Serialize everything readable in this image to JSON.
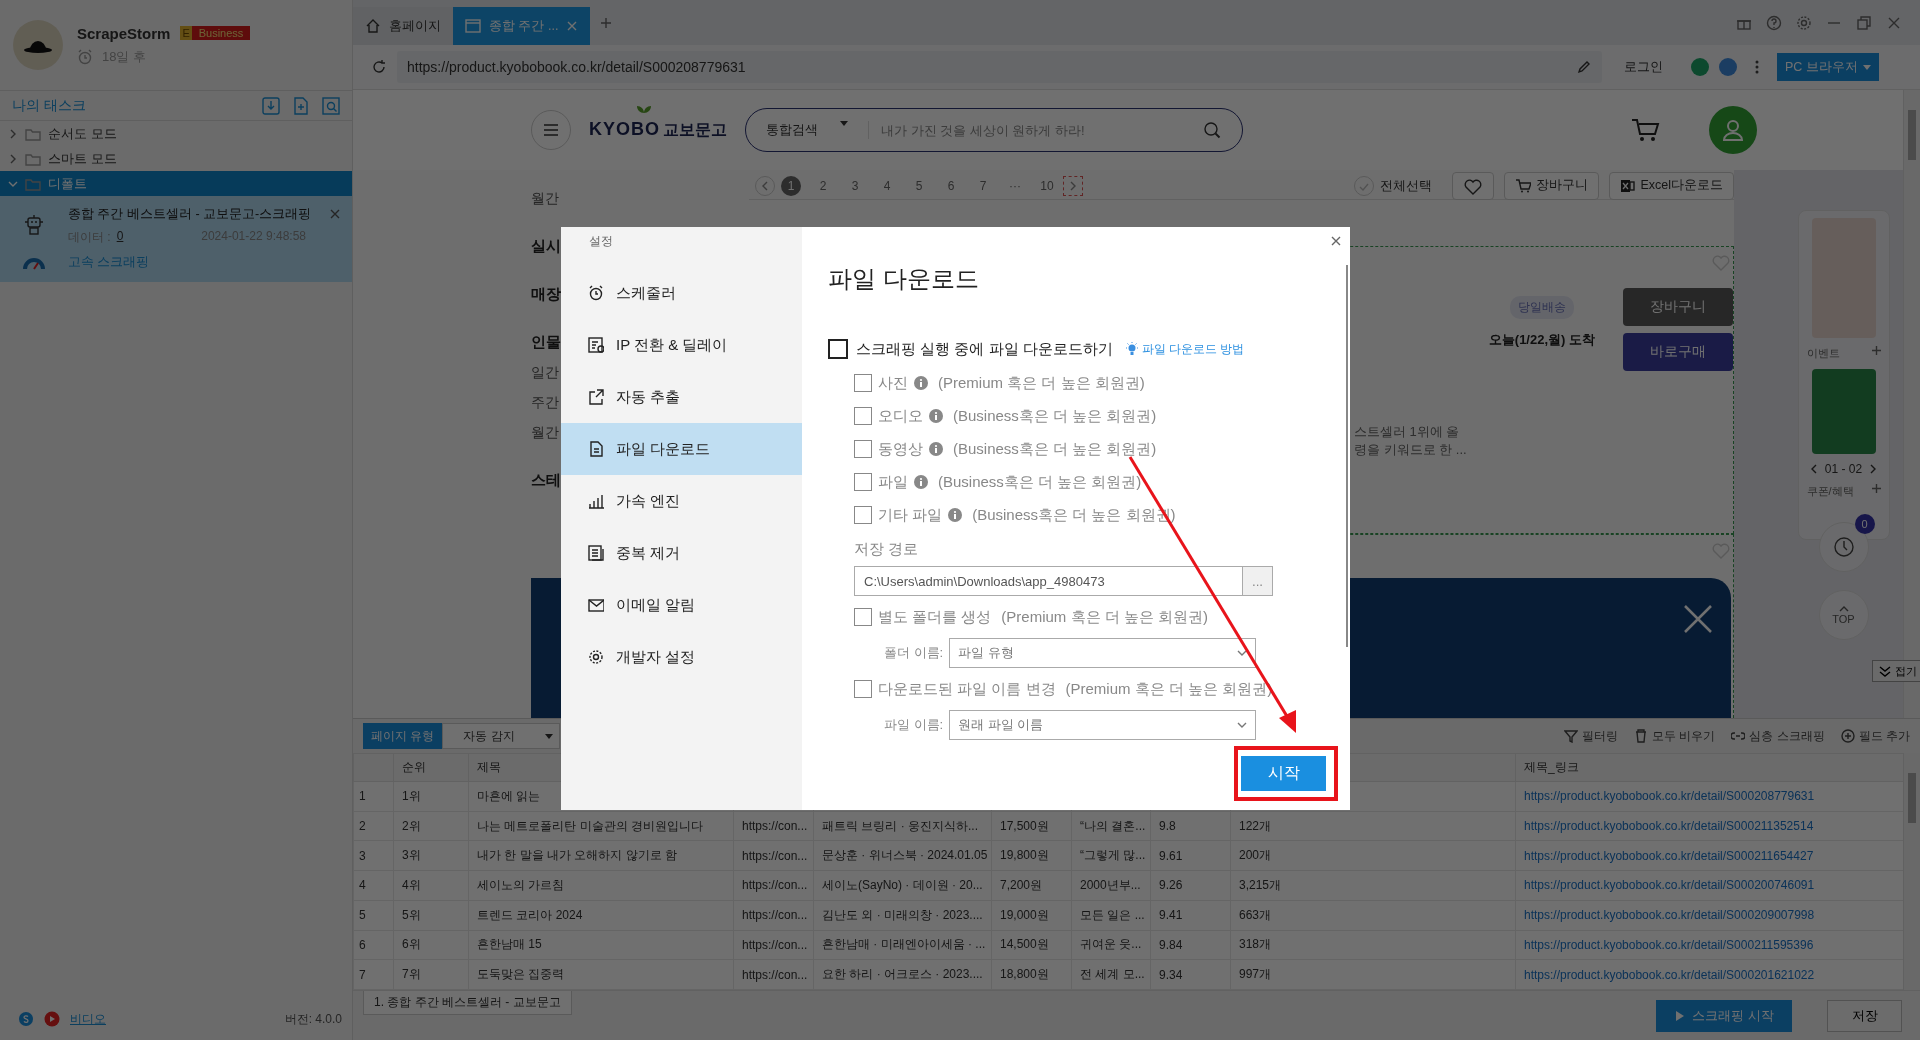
{
  "profile": {
    "app_name": "ScrapeStorm",
    "plan_letter": "E",
    "plan": "Business",
    "expiry": "18일 후"
  },
  "task_panel": {
    "title": "나의 태스크",
    "folders": [
      {
        "label": "순서도 모드",
        "expanded": false,
        "selected": false
      },
      {
        "label": "스마트 모드",
        "expanded": false,
        "selected": false
      },
      {
        "label": "디폴트",
        "expanded": true,
        "selected": true,
        "children": [
          {
            "title": "종합 주간 베스트셀러 - 교보문고-스크래핑",
            "data_label": "데이터 :",
            "data_count": "0",
            "time": "2024-01-22 9:48:58",
            "mode": "고속 스크래핑"
          }
        ]
      }
    ]
  },
  "status_left": {
    "video": "비디오",
    "version": "버전: 4.0.0"
  },
  "browser": {
    "tabs": [
      {
        "label": "홈페이지",
        "selected": false
      },
      {
        "label": "종합 주간 ...",
        "selected": true
      }
    ],
    "url": "https://product.kyobobook.co.kr/detail/S000208779631",
    "login": "로그인",
    "mode_button": "PC 브라우저"
  },
  "site": {
    "logo_latin": "KYOBO",
    "logo_korean": "교보문고",
    "search_category": "통합검색",
    "search_placeholder": "내가 가진 것을 세상이 원하게 하라!",
    "side_labels": [
      {
        "text": "월간",
        "kind": "link"
      },
      {
        "text": "실시",
        "kind": "heading"
      },
      {
        "text": "매장",
        "kind": "heading"
      },
      {
        "text": "인물",
        "kind": "heading"
      },
      {
        "text": "일간",
        "kind": "link"
      },
      {
        "text": "주간",
        "kind": "link"
      },
      {
        "text": "월간",
        "kind": "link"
      },
      {
        "text": "스테",
        "kind": "heading"
      }
    ],
    "pages": [
      {
        "label": "1",
        "selected": true
      },
      {
        "label": "2",
        "selected": false
      },
      {
        "label": "3",
        "selected": false
      },
      {
        "label": "4",
        "selected": false
      },
      {
        "label": "5",
        "selected": false
      },
      {
        "label": "6",
        "selected": false
      },
      {
        "label": "7",
        "selected": false
      },
      {
        "label": "···",
        "selected": false
      },
      {
        "label": "10",
        "selected": false
      }
    ],
    "select_all": "전체선택",
    "select_all_checked": false,
    "cart_button": "장바구니",
    "excel_button": "Excel다운로드",
    "product": {
      "delivery_tag": "당일배송",
      "arrival": "오늘(1/22,월) 도착",
      "cart": "장바구니",
      "buy": "바로구매",
      "description": [
        "스트셀러 1위에 올",
        "령을 키워드로 한 ..."
      ]
    },
    "rail": {
      "events": "이벤트",
      "pager": "01 - 02",
      "coupons": "쿠폰/혜택",
      "recent_count": "0",
      "top": "TOP",
      "collapse": "접기"
    }
  },
  "data_panel": {
    "page_type_label": "페이지 유형",
    "page_type": "자동 감지",
    "actions": [
      {
        "label": "필터링",
        "kind": "filter"
      },
      {
        "label": "모두 비우기",
        "kind": "clear"
      },
      {
        "label": "심층 스크래핑",
        "kind": "link"
      },
      {
        "label": "필드 추가",
        "kind": "add"
      }
    ],
    "columns": [
      "순위",
      "제목",
      null,
      null,
      null,
      null,
      null,
      null,
      "제목_링크"
    ],
    "rows": [
      {
        "number": "1",
        "cells": [
          "1위",
          "마흔에 읽는",
          null,
          null,
          null,
          null,
          null,
          null,
          "https://product.kyobobook.co.kr/detail/S000208779631"
        ]
      },
      {
        "number": "2",
        "cells": [
          "2위",
          "나는 메트로폴리탄 미술관의 경비원입니다",
          "https://con...",
          "패트릭 브링리 · 웅진지식하...",
          "17,500원",
          "“나의 결혼...",
          "9.8",
          "122개",
          "https://product.kyobobook.co.kr/detail/S000211352514"
        ]
      },
      {
        "number": "3",
        "cells": [
          "3위",
          "내가 한 말을 내가 오해하지 않기로 함",
          "https://con...",
          "문상훈 · 위너스북 · 2024.01.05",
          "19,800원",
          "“그렇게 많...",
          "9.61",
          "200개",
          "https://product.kyobobook.co.kr/detail/S000211654427"
        ]
      },
      {
        "number": "4",
        "cells": [
          "4위",
          "세이노의 가르침",
          "https://con...",
          "세이노(SayNo) · 데이원 · 20...",
          "7,200원",
          "2000년부...",
          "9.26",
          "3,215개",
          "https://product.kyobobook.co.kr/detail/S000200746091"
        ]
      },
      {
        "number": "5",
        "cells": [
          "5위",
          "트렌드 코리아 2024",
          "https://con...",
          "김난도 외 · 미래의창 · 2023....",
          "19,000원",
          "모든 일은 ...",
          "9.41",
          "663개",
          "https://product.kyobobook.co.kr/detail/S000209007998"
        ]
      },
      {
        "number": "6",
        "cells": [
          "6위",
          "흔한남매 15",
          "https://con...",
          "흔한남매 · 미래엔아이세움 · ...",
          "14,500원",
          "귀여운 웃...",
          "9.84",
          "318개",
          "https://product.kyobobook.co.kr/detail/S000211595396"
        ]
      },
      {
        "number": "7",
        "cells": [
          "7위",
          "도둑맞은 집중력",
          "https://con...",
          "요한 하리 · 어크로스 · 2023....",
          "18,800원",
          "전 세계 모...",
          "9.34",
          "997개",
          "https://product.kyobobook.co.kr/detail/S000201621022"
        ]
      }
    ]
  },
  "bottom_bar": {
    "task_tab": "1. 종합 주간 베스트셀러 - 교보문고",
    "start_button": "스크래핑 시작",
    "save_button": "저장"
  },
  "settings_dialog": {
    "title": "설정",
    "nav": [
      {
        "label": "스케줄러",
        "selected": false
      },
      {
        "label": "IP 전환 & 딜레이",
        "selected": false
      },
      {
        "label": "자동 추출",
        "selected": false
      },
      {
        "label": "파일 다운로드",
        "selected": true
      },
      {
        "label": "가속 엔진",
        "selected": false
      },
      {
        "label": "중복 제거",
        "selected": false
      },
      {
        "label": "이메일 알림",
        "selected": false
      },
      {
        "label": "개발자 설정",
        "selected": false
      }
    ],
    "heading": "파일 다운로드",
    "main_option": {
      "label": "스크래핑 실행 중에 파일 다운로드하기",
      "checked": false
    },
    "help_link": "파일 다운로드 방법",
    "file_types": [
      {
        "label": "사진",
        "note": "(Premium 혹은 더 높은 회원권)",
        "checked": false,
        "disabled": true
      },
      {
        "label": "오디오",
        "note": "(Business혹은 더 높은 회원권)",
        "checked": false,
        "disabled": true
      },
      {
        "label": "동영상",
        "note": "(Business혹은 더 높은 회원권)",
        "checked": false,
        "disabled": true
      },
      {
        "label": "파일",
        "note": "(Business혹은 더 높은 회원권)",
        "checked": false,
        "disabled": true
      },
      {
        "label": "기타 파일",
        "note": "(Business혹은 더 높은 회원권)",
        "checked": false,
        "disabled": true
      }
    ],
    "path_label": "저장 경로",
    "path": "C:\\Users\\admin\\Downloads\\app_4980473",
    "browse": "...",
    "folder_option": {
      "label": "별도 폴더를 생성",
      "note": "(Premium 혹은 더 높은 회원권)",
      "checked": false,
      "disabled": true
    },
    "folder_name_label": "폴더 이름:",
    "folder_name": "파일 유형",
    "rename_option": {
      "label": "다운로드된 파일 이름 변경",
      "note": "(Premium 혹은 더 높은 회원권)",
      "checked": false,
      "disabled": true
    },
    "file_name_label": "파일 이름:",
    "file_name": "원래 파일 이름",
    "start": "시작"
  }
}
